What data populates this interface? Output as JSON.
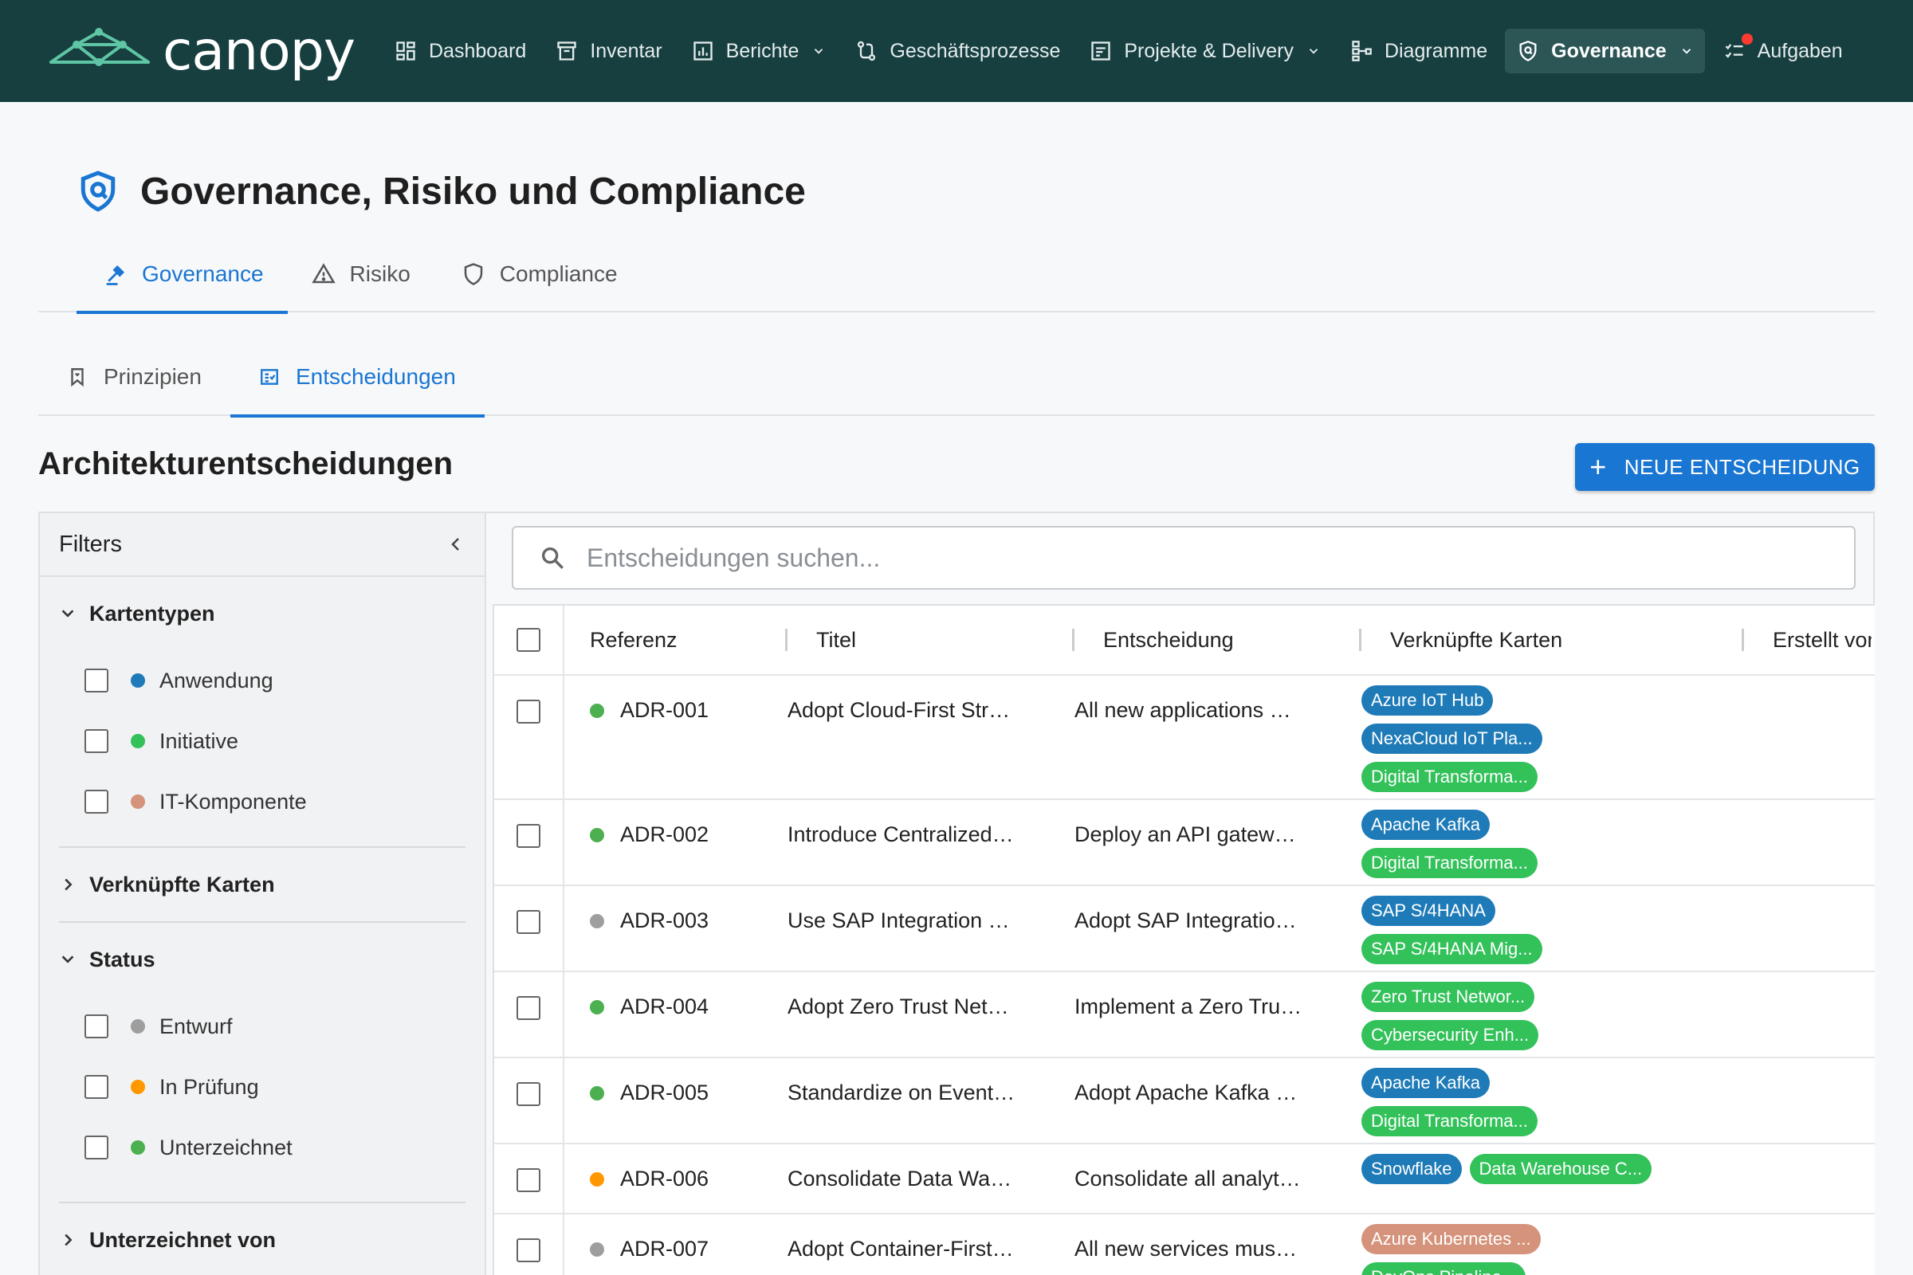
{
  "app": {
    "name": "canopy"
  },
  "nav": {
    "items": [
      {
        "label": "Dashboard",
        "icon": "dashboard-icon"
      },
      {
        "label": "Inventar",
        "icon": "archive-icon"
      },
      {
        "label": "Berichte",
        "icon": "bar-chart-icon",
        "dropdown": true
      },
      {
        "label": "Geschäftsprozesse",
        "icon": "process-flow-icon"
      },
      {
        "label": "Projekte & Delivery",
        "icon": "project-icon",
        "dropdown": true
      },
      {
        "label": "Diagramme",
        "icon": "diagram-icon"
      },
      {
        "label": "Governance",
        "icon": "shield-icon",
        "dropdown": true,
        "active": true
      },
      {
        "label": "Aufgaben",
        "icon": "tasks-icon",
        "notification": true
      }
    ]
  },
  "page": {
    "title": "Governance, Risiko und Compliance"
  },
  "tabs": [
    {
      "label": "Governance",
      "active": true
    },
    {
      "label": "Risiko"
    },
    {
      "label": "Compliance"
    }
  ],
  "subtabs": [
    {
      "label": "Prinzipien"
    },
    {
      "label": "Entscheidungen",
      "active": true
    }
  ],
  "section": {
    "title": "Architekturentscheidungen",
    "new_button": "NEUE ENTSCHEIDUNG"
  },
  "filters": {
    "title": "Filters",
    "groups": [
      {
        "label": "Kartentypen",
        "expanded": true,
        "options": [
          {
            "label": "Anwendung",
            "color": "#1e7bb8"
          },
          {
            "label": "Initiative",
            "color": "#33c15a"
          },
          {
            "label": "IT-Komponente",
            "color": "#d4937a"
          }
        ]
      },
      {
        "label": "Verknüpfte Karten",
        "expanded": false
      },
      {
        "label": "Status",
        "expanded": true,
        "options": [
          {
            "label": "Entwurf",
            "color": "#9e9e9e"
          },
          {
            "label": "In Prüfung",
            "color": "#ff9800"
          },
          {
            "label": "Unterzeichnet",
            "color": "#4caf50"
          }
        ]
      },
      {
        "label": "Unterzeichnet von",
        "expanded": false
      }
    ]
  },
  "search": {
    "placeholder": "Entscheidungen suchen..."
  },
  "table": {
    "columns": [
      "Referenz",
      "Titel",
      "Entscheidung",
      "Verknüpfte Karten",
      "Erstellt von"
    ],
    "rows": [
      {
        "ref": "ADR-001",
        "status_color": "#4caf50",
        "title": "Adopt Cloud-First Str…",
        "decision": "All new applications …",
        "cards": [
          {
            "label": "Azure IoT Hub",
            "color": "#1e7bb8"
          },
          {
            "label": "NexaCloud IoT Pla...",
            "color": "#1e7bb8"
          },
          {
            "label": "Digital Transforma...",
            "color": "#33c15a"
          }
        ]
      },
      {
        "ref": "ADR-002",
        "status_color": "#4caf50",
        "title": "Introduce Centralized…",
        "decision": "Deploy an API gatew…",
        "cards": [
          {
            "label": "Apache Kafka",
            "color": "#1e7bb8"
          },
          {
            "label": "Digital Transforma...",
            "color": "#33c15a"
          }
        ]
      },
      {
        "ref": "ADR-003",
        "status_color": "#9e9e9e",
        "title": "Use SAP Integration …",
        "decision": "Adopt SAP Integratio…",
        "cards": [
          {
            "label": "SAP S/4HANA",
            "color": "#1e7bb8"
          },
          {
            "label": "SAP S/4HANA Mig...",
            "color": "#33c15a"
          }
        ]
      },
      {
        "ref": "ADR-004",
        "status_color": "#4caf50",
        "title": "Adopt Zero Trust Net…",
        "decision": "Implement a Zero Tru…",
        "cards": [
          {
            "label": "Zero Trust Networ...",
            "color": "#33c15a"
          },
          {
            "label": "Cybersecurity Enh...",
            "color": "#33c15a"
          }
        ]
      },
      {
        "ref": "ADR-005",
        "status_color": "#4caf50",
        "title": "Standardize on Event…",
        "decision": "Adopt Apache Kafka …",
        "cards": [
          {
            "label": "Apache Kafka",
            "color": "#1e7bb8"
          },
          {
            "label": "Digital Transforma...",
            "color": "#33c15a"
          }
        ]
      },
      {
        "ref": "ADR-006",
        "status_color": "#ff9800",
        "title": "Consolidate Data Wa…",
        "decision": "Consolidate all analyt…",
        "cards_inline": true,
        "cards": [
          {
            "label": "Snowflake",
            "color": "#1e7bb8"
          },
          {
            "label": "Data Warehouse C...",
            "color": "#33c15a"
          }
        ]
      },
      {
        "ref": "ADR-007",
        "status_color": "#9e9e9e",
        "title": "Adopt Container-First…",
        "decision": "All new services mus…",
        "cards": [
          {
            "label": "Azure Kubernetes ...",
            "color": "#d4937a"
          },
          {
            "label": "DevOps Pipeline...",
            "color": "#33c15a"
          }
        ]
      }
    ]
  }
}
